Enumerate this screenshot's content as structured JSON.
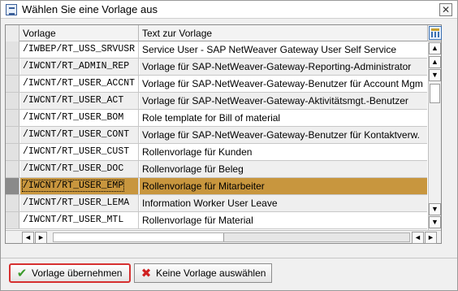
{
  "window": {
    "title": "Wählen Sie eine Vorlage aus",
    "close_glyph": "✕"
  },
  "table": {
    "columns": [
      "Vorlage",
      "Text zur Vorlage"
    ],
    "rows": [
      {
        "template": "/IWBEP/RT_USS_SRVUSR",
        "text": "Service User - SAP NetWeaver Gateway User Self Service"
      },
      {
        "template": "/IWCNT/RT_ADMIN_REP",
        "text": "Vorlage für SAP-NetWeaver-Gateway-Reporting-Administrator"
      },
      {
        "template": "/IWCNT/RT_USER_ACCNT",
        "text": "Vorlage für SAP-NetWeaver-Gateway-Benutzer für Account Mgm"
      },
      {
        "template": "/IWCNT/RT_USER_ACT",
        "text": "Vorlage für SAP-NetWeaver-Gateway-Aktivitätsmgt.-Benutzer"
      },
      {
        "template": "/IWCNT/RT_USER_BOM",
        "text": "Role template for Bill of material"
      },
      {
        "template": "/IWCNT/RT_USER_CONT",
        "text": "Vorlage für SAP-NetWeaver-Gateway-Benutzer für Kontaktverw."
      },
      {
        "template": "/IWCNT/RT_USER_CUST",
        "text": "Rollenvorlage für Kunden"
      },
      {
        "template": "/IWCNT/RT_USER_DOC",
        "text": "Rollenvorlage für Beleg"
      },
      {
        "template": "/IWCNT/RT_USER_EMP",
        "text": "Rollenvorlage für Mitarbeiter"
      },
      {
        "template": "/IWCNT/RT_USER_LEMA",
        "text": "Information Worker User Leave"
      },
      {
        "template": "/IWCNT/RT_USER_MTL",
        "text": "Rollenvorlage für Material"
      }
    ],
    "selected_row": "/IWCNT/RT_USER_EMP",
    "colors": {
      "selected": "#c8963e",
      "alt_row": "#efefef"
    }
  },
  "scroll": {
    "up_glyph": "▲",
    "down_glyph": "▼",
    "left_glyph": "◄",
    "right_glyph": "►"
  },
  "buttons": {
    "accept_label": "Vorlage übernehmen",
    "accept_icon": "✔",
    "none_label": "Keine Vorlage auswählen",
    "none_icon": "✖"
  }
}
